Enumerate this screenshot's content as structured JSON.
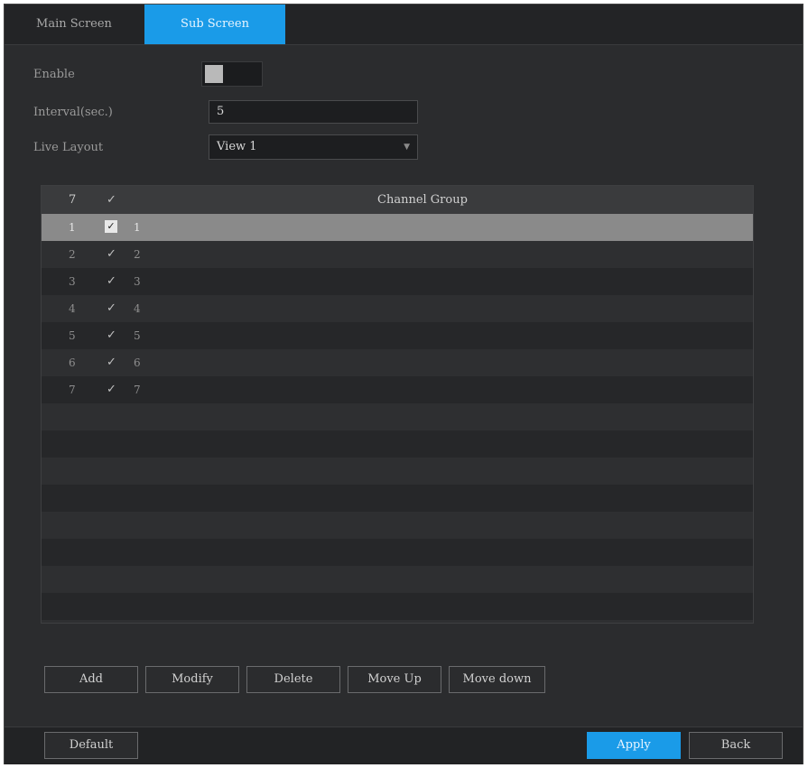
{
  "tabs": [
    {
      "label": "Main Screen",
      "active": false
    },
    {
      "label": "Sub Screen",
      "active": true
    }
  ],
  "form": {
    "enable_label": "Enable",
    "enable_on": false,
    "interval_label": "Interval(sec.)",
    "interval_value": "5",
    "layout_label": "Live Layout",
    "layout_value": "View 1"
  },
  "table": {
    "header": {
      "count": "7",
      "check": "✓",
      "column": "Channel Group"
    },
    "rows": [
      {
        "index": "1",
        "checked": true,
        "group": "1",
        "selected": true
      },
      {
        "index": "2",
        "checked": true,
        "group": "2",
        "selected": false
      },
      {
        "index": "3",
        "checked": true,
        "group": "3",
        "selected": false
      },
      {
        "index": "4",
        "checked": true,
        "group": "4",
        "selected": false
      },
      {
        "index": "5",
        "checked": true,
        "group": "5",
        "selected": false
      },
      {
        "index": "6",
        "checked": true,
        "group": "6",
        "selected": false
      },
      {
        "index": "7",
        "checked": true,
        "group": "7",
        "selected": false
      }
    ]
  },
  "actions": {
    "add": "Add",
    "modify": "Modify",
    "delete": "Delete",
    "move_up": "Move Up",
    "move_down": "Move down"
  },
  "footer": {
    "default": "Default",
    "apply": "Apply",
    "back": "Back"
  },
  "colors": {
    "accent": "#1a9be8",
    "background": "#2b2c2e"
  }
}
